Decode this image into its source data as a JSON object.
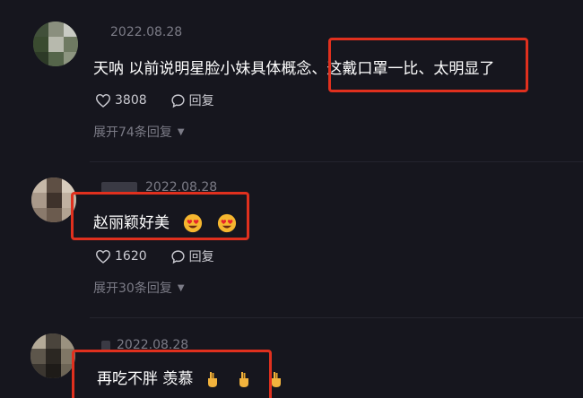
{
  "comments": [
    {
      "date": "2022.08.28",
      "text_a": "天呐 以前说明星脸小妹具体概念、",
      "text_b": "这戴口罩一比、太明显了",
      "likes": "3808",
      "reply_label": "回复",
      "replies": "展开74条回复"
    },
    {
      "date": "2022.08.28",
      "text": "赵丽颖好美",
      "emojis": [
        "heart-eyes-icon",
        "heart-eyes-icon"
      ],
      "likes": "1620",
      "reply_label": "回复",
      "replies": "展开30条回复"
    },
    {
      "date": "2022.08.28",
      "text": "再吃不胖 羡慕",
      "emojis": [
        "fingers-crossed-icon",
        "fingers-crossed-icon",
        "fingers-crossed-icon"
      ]
    }
  ],
  "colors": {
    "background": "#16161e",
    "muted": "#7b7b86",
    "highlight": "#e0301e"
  }
}
